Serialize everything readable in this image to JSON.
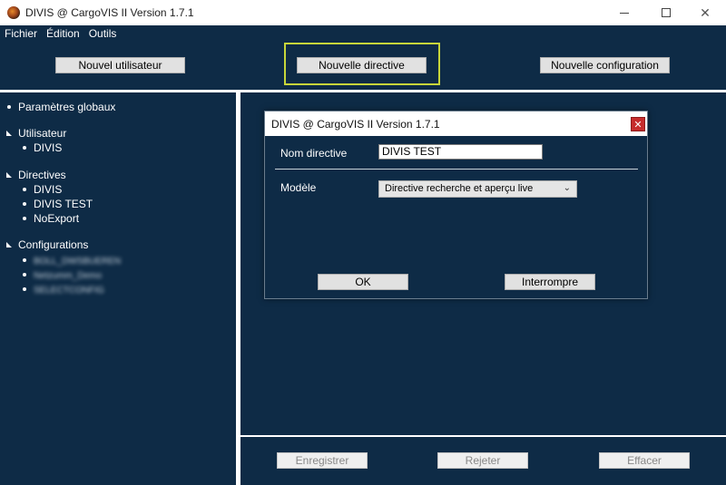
{
  "window": {
    "title": "DIVIS @ CargoVIS II Version 1.7.1",
    "controls": {
      "minimize": "",
      "maximize": "",
      "close": "✕"
    }
  },
  "menu": [
    {
      "label": "Fichier"
    },
    {
      "label": "Édition"
    },
    {
      "label": "Outils"
    }
  ],
  "toolbar": {
    "new_user": "Nouvel utilisateur",
    "new_directive": "Nouvelle directive",
    "new_configuration": "Nouvelle configuration"
  },
  "tree": {
    "global_params": "Paramètres globaux",
    "users": {
      "label": "Utilisateur",
      "items": [
        "DIVIS"
      ]
    },
    "directives": {
      "label": "Directives",
      "items": [
        "DIVIS",
        "DIVIS TEST",
        "NoExport"
      ]
    },
    "configurations": {
      "label": "Configurations",
      "items": [
        "BOLL_DWSBUEREN",
        "Netzumm_Demo",
        "SELECTCONFIG"
      ]
    }
  },
  "bottom": {
    "save": "Enregistrer",
    "reject": "Rejeter",
    "clear": "Effacer"
  },
  "dialog": {
    "title": "DIVIS @ CargoVIS II Version 1.7.1",
    "close": "✕",
    "name_label": "Nom directive",
    "name_value": "DIVIS TEST",
    "model_label": "Modèle",
    "model_value": "Directive recherche et aperçu live",
    "ok": "OK",
    "cancel": "Interrompre"
  },
  "colors": {
    "background": "#0e2b46",
    "focus": "#c8d63a",
    "close": "#c62c2c"
  }
}
